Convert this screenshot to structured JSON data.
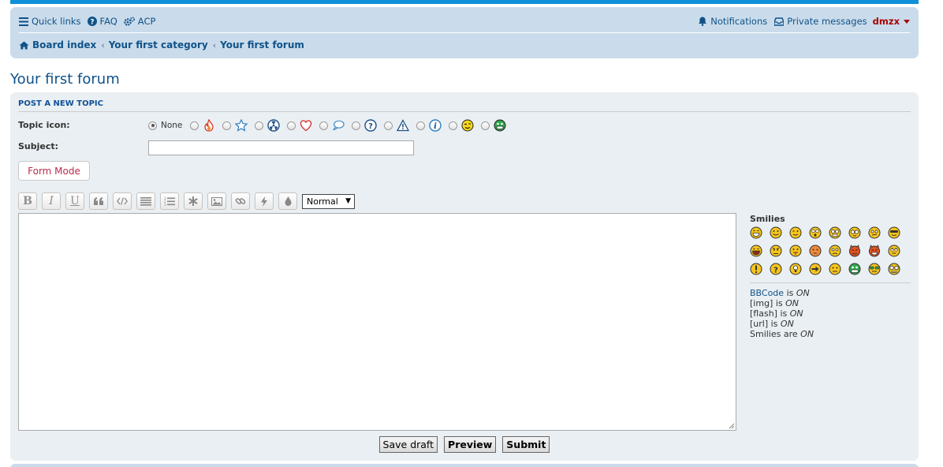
{
  "nav": {
    "quick_links": "Quick links",
    "faq": "FAQ",
    "acp": "ACP",
    "notifications": "Notifications",
    "private_messages": "Private messages",
    "username": "dmzx"
  },
  "breadcrumbs": [
    "Board index",
    "Your first category",
    "Your first forum"
  ],
  "page_title": "Your first forum",
  "panel": {
    "header": "POST A NEW TOPIC",
    "topic_icon_label": "Topic icon:",
    "none_label": "None",
    "topic_icons": [
      "fire-icon",
      "star-icon",
      "radioactive-icon",
      "heart-icon",
      "speech-bubble-icon",
      "question-icon",
      "warning-icon",
      "info-icon",
      "smiley-wink-icon",
      "smiley-grin-icon"
    ],
    "subject_label": "Subject:",
    "subject_value": "",
    "form_mode": "Form Mode",
    "toolbar": {
      "bold": "B",
      "italic": "I",
      "underline": "U",
      "font_size": "Normal"
    },
    "smilies_title": "Smilies",
    "status": {
      "bbcode_link": "BBCode",
      "bbcode_is": "is",
      "bbcode_state": "ON",
      "img": "[img] is",
      "img_state": "ON",
      "flash": "[flash] is",
      "flash_state": "ON",
      "url": "[url] is",
      "url_state": "ON",
      "smilies": "Smilies are",
      "smilies_state": "ON"
    },
    "buttons": {
      "save_draft": "Save draft",
      "preview": "Preview",
      "submit": "Submit"
    }
  },
  "colors": {
    "accent_blue": "#0f90d8",
    "nav_bg": "#cadceb",
    "link": "#105289",
    "username": "#aa0000",
    "panel_bg": "#e9eff2"
  }
}
